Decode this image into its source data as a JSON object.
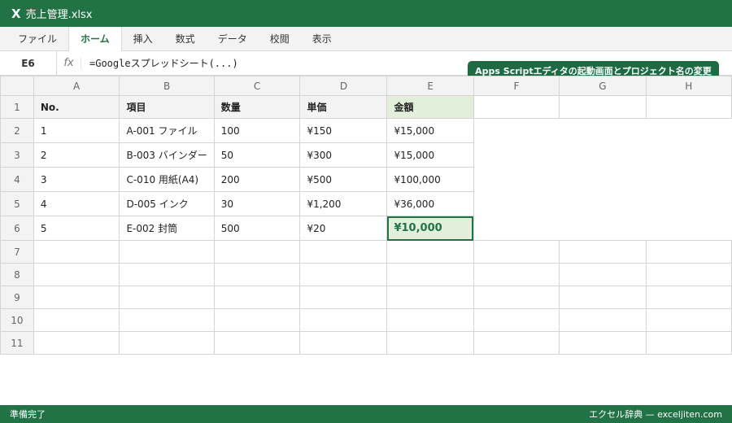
{
  "app": {
    "icon_glyph": "X",
    "file_name": "売上管理.xlsx",
    "accent": "#217346"
  },
  "ribbon": {
    "tabs": [
      "ファイル",
      "ホーム",
      "挿入",
      "数式",
      "データ",
      "校閲",
      "表示"
    ],
    "active": "ホーム"
  },
  "formula_bar": {
    "cell_ref": "E6",
    "fx_label": "fx",
    "formula": "=Googleスプレッドシート(...)"
  },
  "callout": "Apps Scriptエディタの起動画面とプロジェクト名の変更",
  "sheet": {
    "columns": [
      "A",
      "B",
      "C",
      "D",
      "E",
      "F",
      "G",
      "H"
    ],
    "row_numbers": [
      "1",
      "2",
      "3",
      "4",
      "5",
      "6",
      "7",
      "8",
      "9",
      "10",
      "11"
    ],
    "header_row": [
      "No.",
      "項目",
      "数量",
      "単価",
      "金額"
    ],
    "data_rows": [
      [
        "1",
        "A-001 ファイル",
        "100",
        "¥150",
        "¥15,000"
      ],
      [
        "2",
        "B-003 バインダー",
        "50",
        "¥300",
        "¥15,000"
      ],
      [
        "3",
        "C-010 用紙(A4)",
        "200",
        "¥500",
        "¥100,000"
      ],
      [
        "4",
        "D-005 インク",
        "30",
        "¥1,200",
        "¥36,000"
      ],
      [
        "5",
        "E-002 封筒",
        "500",
        "¥20",
        "¥10,000"
      ]
    ]
  },
  "status": {
    "left": "準備完了",
    "right": "エクセル辞典 — exceljiten.com"
  }
}
